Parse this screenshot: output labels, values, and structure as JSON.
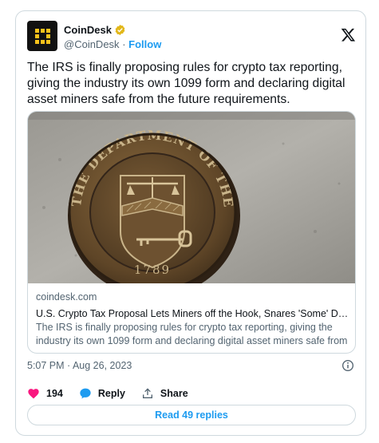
{
  "author": {
    "name": "CoinDesk",
    "handle": "@CoinDesk",
    "separator": "·",
    "follow_label": "Follow"
  },
  "tweet": {
    "text": "The IRS is finally proposing rules for crypto tax reporting, giving the industry its own 1099 form and declaring digital asset miners safe from the future requirements.",
    "timestamp": "5:07 PM · Aug 26, 2023"
  },
  "link_card": {
    "domain": "coindesk.com",
    "title": "U.S. Crypto Tax Proposal Lets Miners off the Hook, Snares 'Some' Decent...",
    "description": "The IRS is finally proposing rules for crypto tax reporting, giving the industry its own 1099 form and declaring digital asset miners safe from ...",
    "image_alt": "The Department of the Treasury 1789"
  },
  "seal": {
    "top_text": "THE DEPARTMENT OF THE TREASURY",
    "year": "1789"
  },
  "actions": {
    "like_count": "194",
    "reply_label": "Reply",
    "share_label": "Share",
    "read_replies_label": "Read 49 replies"
  },
  "colors": {
    "accent": "#1d9bf0",
    "like": "#f91880",
    "brand_yellow": "#f7c21b"
  }
}
